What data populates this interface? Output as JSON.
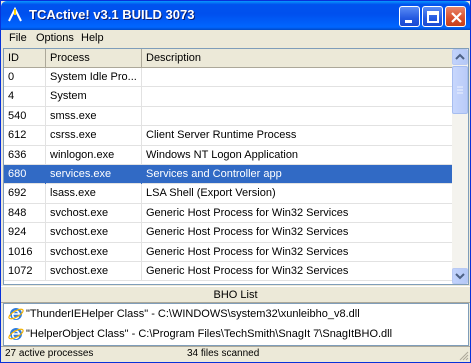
{
  "window": {
    "title": "TCActive! v3.1 BUILD 3073",
    "titlebar_color": "#0054e3"
  },
  "menu": {
    "file": "File",
    "options": "Options",
    "help": "Help"
  },
  "list": {
    "columns": {
      "id": "ID",
      "process": "Process",
      "description": "Description"
    },
    "selected_index": 5,
    "selection_color": "#316ac5",
    "rows": [
      {
        "id": "0",
        "process": "System Idle Pro...",
        "description": ""
      },
      {
        "id": "4",
        "process": "System",
        "description": ""
      },
      {
        "id": "540",
        "process": "smss.exe",
        "description": ""
      },
      {
        "id": "612",
        "process": "csrss.exe",
        "description": "Client Server Runtime Process"
      },
      {
        "id": "636",
        "process": "winlogon.exe",
        "description": "Windows NT Logon Application"
      },
      {
        "id": "680",
        "process": "services.exe",
        "description": "Services and Controller app"
      },
      {
        "id": "692",
        "process": "lsass.exe",
        "description": "LSA Shell (Export Version)"
      },
      {
        "id": "848",
        "process": "svchost.exe",
        "description": "Generic Host Process for Win32 Services"
      },
      {
        "id": "924",
        "process": "svchost.exe",
        "description": "Generic Host Process for Win32 Services"
      },
      {
        "id": "1016",
        "process": "svchost.exe",
        "description": "Generic Host Process for Win32 Services"
      },
      {
        "id": "1072",
        "process": "svchost.exe",
        "description": "Generic Host Process for Win32 Services"
      }
    ]
  },
  "bho": {
    "title": "BHO List",
    "items": [
      {
        "label": "\"ThunderIEHelper Class\" - C:\\WINDOWS\\system32\\xunleibho_v8.dll",
        "icon": "ie-icon"
      },
      {
        "label": "\"HelperObject Class\" - C:\\Program Files\\TechSmith\\SnagIt 7\\SnagItBHO.dll",
        "icon": "ie-icon"
      }
    ]
  },
  "status": {
    "processes": "27 active processes",
    "files": "34 files scanned"
  }
}
